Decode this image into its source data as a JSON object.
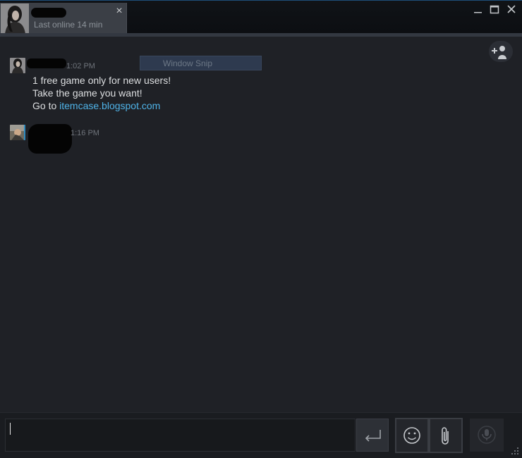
{
  "tab": {
    "status": "Last online 14 min",
    "close_glyph": "×"
  },
  "window": {
    "minimize_icon": "minimize-icon",
    "maximize_icon": "maximize-icon",
    "close_icon": "close-icon"
  },
  "messages": [
    {
      "time": "1:02 PM",
      "lines": [
        "1 free game only for new users!",
        "Take the game you want!"
      ],
      "link_prefix": "Go to ",
      "link": "itemcase.blogspot.com"
    },
    {
      "time": "1:16 PM"
    }
  ],
  "overlay": {
    "label": "Window Snip"
  },
  "composer": {
    "value": "",
    "send_icon": "enter-arrow-icon",
    "emoticon_icon": "smiley-icon",
    "attach_icon": "paperclip-icon",
    "voice_icon": "microphone-icon"
  },
  "colors": {
    "background": "#1f2126",
    "link": "#4fb3e8",
    "accent_border": "#1d4f7a"
  }
}
